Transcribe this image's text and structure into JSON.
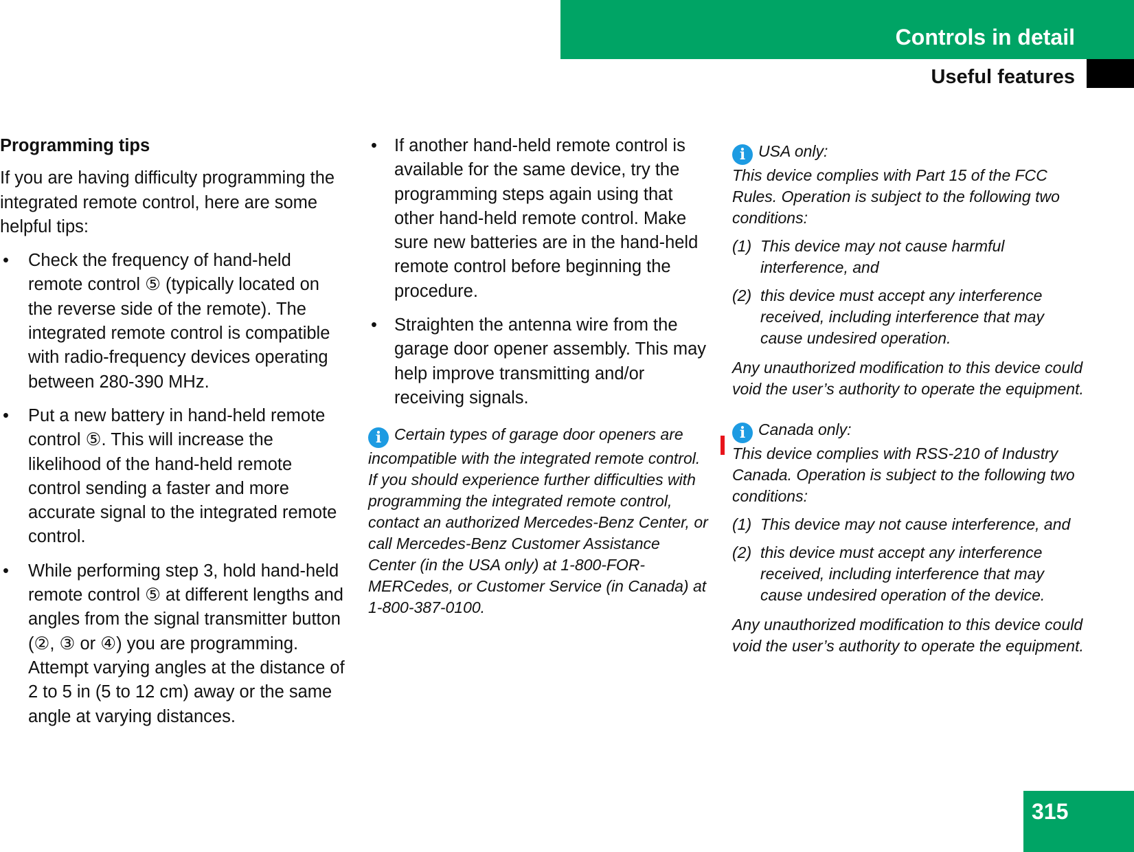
{
  "header": {
    "section": "Controls in detail",
    "subsection": "Useful features",
    "accent_color": "#00a465"
  },
  "col1": {
    "heading": "Programming tips",
    "intro": "If you are having difficulty programming the integrated remote control, here are some helpful tips:",
    "bullets": [
      "Check the frequency of hand-held remote control ⑤ (typically located on the reverse side of the remote). The integrated remote control is compatible with radio-frequency devices operating between 280-390 MHz.",
      "Put a new battery in hand-held remote control ⑤. This will increase the likelihood of the hand-held remote control sending a faster and more accurate signal to the integrated remote control.",
      "While performing step 3, hold hand-held remote control ⑤ at different lengths and angles from the signal transmitter button (②, ③ or ④) you are programming. Attempt varying angles at the distance of 2 to 5 in (5 to 12 cm) away or the same angle at varying distances."
    ]
  },
  "col2": {
    "bullets": [
      "If another hand-held remote control is available for the same device, try the programming steps again using that other hand-held remote control. Make sure new batteries are in the hand-held remote control before beginning the procedure.",
      "Straighten the antenna wire from the garage door opener assembly. This may help improve transmitting and/or receiving signals."
    ],
    "note": "Certain types of garage door openers are incompatible with the integrated remote control. If you should experience further difficulties with programming the integrated remote control, contact an authorized Mercedes-Benz Center, or call Mercedes-Benz Customer Assistance Center (in the USA only) at 1-800-FOR-MERCedes, or Customer Service (in Canada) at 1-800-387-0100."
  },
  "usa": {
    "title": "USA only:",
    "text": "This device complies with Part 15 of the FCC Rules. Operation is subject to the following two conditions:",
    "conditions": [
      {
        "n": "(1)",
        "t": "This device may not cause harmful interference, and"
      },
      {
        "n": "(2)",
        "t": "this device must accept any interference received, including interference that may cause undesired operation."
      }
    ],
    "footer": "Any unauthorized modification to this device could void the user’s authority to operate the equipment."
  },
  "canada": {
    "title": "Canada only:",
    "text": "This device complies with RSS-210 of Industry Canada. Operation is subject to the following two conditions:",
    "conditions": [
      {
        "n": "(1)",
        "t": "This device may not cause interference, and"
      },
      {
        "n": "(2)",
        "t": "this device must accept any interference received, including interference that may cause undesired operation of the device."
      }
    ],
    "footer": "Any unauthorized modification to this device could void the user’s authority to operate the equipment."
  },
  "info_icon_glyph": "i",
  "page_number": "315"
}
